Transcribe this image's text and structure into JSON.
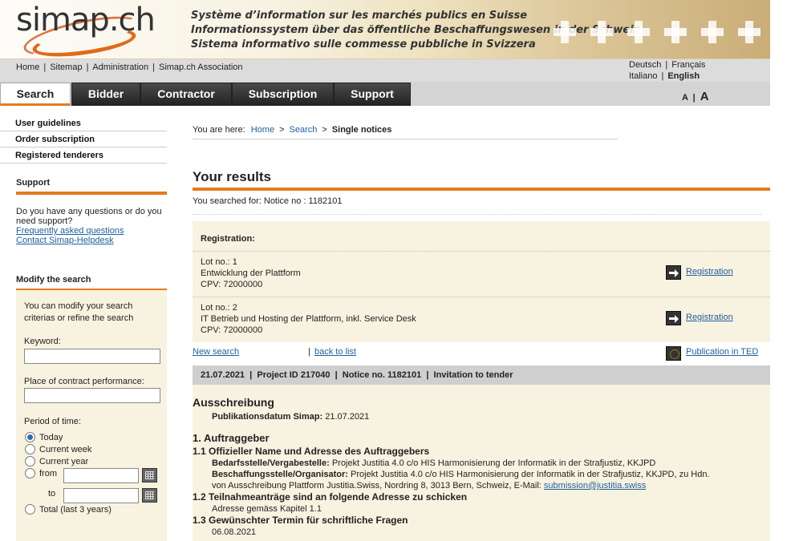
{
  "header": {
    "logo_text": "simap.ch",
    "tagline_fr": "Système d’information sur les marchés publics en Suisse",
    "tagline_de": "Informationssystem über das öffentliche Beschaffungswesen in der Schweiz",
    "tagline_it": "Sistema informativo sulle commesse pubbliche in Svizzera"
  },
  "topnav": {
    "links": [
      "Home",
      "Sitemap",
      "Administration",
      "Simap.ch Association"
    ],
    "sep": "|",
    "languages": {
      "de": "Deutsch",
      "fr": "Français",
      "it": "Italiano",
      "en": "English"
    }
  },
  "tabs": [
    "Search",
    "Bidder",
    "Contractor",
    "Subscription",
    "Support"
  ],
  "font_size": {
    "small": "A",
    "sep": "|",
    "large": "A"
  },
  "left_nav": [
    "User guidelines",
    "Order subscription",
    "Registered tenderers"
  ],
  "support": {
    "title": "Support",
    "text": "Do you have any questions or do you need support?",
    "links": [
      "Frequently asked questions",
      "Contact Simap-Helpdesk"
    ]
  },
  "modify": {
    "title": "Modify the search",
    "intro": "You can modify your search criterias or refine the search",
    "keyword_label": "Keyword:",
    "keyword_value": "",
    "place_label": "Place of contract performance:",
    "place_value": "",
    "period_label": "Period of time:",
    "options": [
      "Today",
      "Current week",
      "Current year",
      "from",
      "Total (last 3 years)"
    ],
    "selected": "Today",
    "to_label": "to"
  },
  "breadcrumb": {
    "prefix": "You are here:",
    "items": [
      "Home",
      "Search"
    ],
    "current": "Single notices",
    "sep": ">"
  },
  "results": {
    "title": "Your results",
    "searched_for": "You searched for: Notice no : 1182101"
  },
  "registration": {
    "heading": "Registration:",
    "lots": [
      {
        "lot": "Lot no.: 1",
        "name": "Entwicklung der Plattform",
        "cpv": "CPV: 72000000",
        "link": "Registration"
      },
      {
        "lot": "Lot no.: 2",
        "name": "IT Betrieb und Hosting der Plattform, inkl. Service Desk",
        "cpv": "CPV: 72000000",
        "link": "Registration"
      }
    ]
  },
  "actions": {
    "new_search": "New search",
    "sep": "|",
    "back": "back to list",
    "ted": "Publication in TED"
  },
  "infobar": "21.07.2021  |  Project ID 217040  |  Notice no. 1182101  |  Invitation to tender",
  "doc": {
    "h_ausschreibung": "Ausschreibung",
    "pub_label": "Publikationsdatum Simap:",
    "pub_value": "21.07.2021",
    "h_1": "1. Auftraggeber",
    "h_1_1": "1.1 Offizieller Name und Adresse des Auftraggebers",
    "bedarf_label": "Bedarfsstelle/Vergabestelle:",
    "bedarf_value": "Projekt Justitia 4.0 c/o HIS Harmonisierung der Informatik in der Strafjustiz, KKJPD",
    "beschaff_label": "Beschaffungsstelle/Organisator:",
    "beschaff_value": "Projekt Justitia 4.0 c/o HIS Harmonisierung der Informatik in der Strafjustiz, KKJPD,  zu Hdn.",
    "beschaff_line2": "von Ausschreibung Plattform Justitia.Swiss, Nordring 8,  3013  Bern,  Schweiz,  E-Mail:",
    "email": "submission@justitia.swiss",
    "h_1_2": "1.2 Teilnahmeanträge sind an folgende Adresse zu schicken",
    "addr": "Adresse gemäss Kapitel 1.1",
    "h_1_3": "1.3 Gewünschter Termin für schriftliche Fragen",
    "date_q": "06.08.2021"
  }
}
